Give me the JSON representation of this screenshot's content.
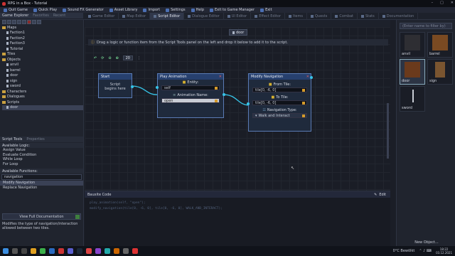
{
  "window": {
    "title": "RPG in a Box - Tutorial"
  },
  "menu": [
    {
      "label": "Quit Game"
    },
    {
      "label": "Quick Play"
    },
    {
      "label": "Sound FX Generator"
    },
    {
      "label": "Asset Library"
    },
    {
      "label": "Import"
    },
    {
      "label": "Settings"
    },
    {
      "label": "Help"
    },
    {
      "label": "Exit to Game Manager"
    },
    {
      "label": "Exit"
    }
  ],
  "tabs": [
    {
      "label": "Game Editor"
    },
    {
      "label": "Map Editor"
    },
    {
      "label": "Script Editor"
    },
    {
      "label": "Dialogue Editor"
    },
    {
      "label": "UI Editor"
    },
    {
      "label": "Effect Editor"
    },
    {
      "label": "Items"
    },
    {
      "label": "Quests"
    },
    {
      "label": "Combat"
    },
    {
      "label": "Stats"
    },
    {
      "label": "Documentation"
    }
  ],
  "left": {
    "explorer_tabs": [
      "Game Explorer",
      "Favorites",
      "Recent"
    ],
    "tree": [
      {
        "label": "Maps",
        "type": "folder"
      },
      {
        "label": "Faction1",
        "type": "file"
      },
      {
        "label": "Faction2",
        "type": "file"
      },
      {
        "label": "Faction3",
        "type": "file"
      },
      {
        "label": "Tutorial",
        "type": "file"
      },
      {
        "label": "Tiles",
        "type": "folder"
      },
      {
        "label": "Objects",
        "type": "folder"
      },
      {
        "label": "anvil",
        "type": "file"
      },
      {
        "label": "barrel",
        "type": "file"
      },
      {
        "label": "door",
        "type": "file"
      },
      {
        "label": "sign",
        "type": "file"
      },
      {
        "label": "sword",
        "type": "file"
      },
      {
        "label": "Characters",
        "type": "folder"
      },
      {
        "label": "Dialogues",
        "type": "folder"
      },
      {
        "label": "Scripts",
        "type": "folder"
      },
      {
        "label": "door",
        "type": "file",
        "selected": true
      }
    ],
    "tools_tabs": [
      "Script Tools",
      "Properties"
    ],
    "logic_header": "Available Logic:",
    "logic": [
      "Assign Value",
      "Evaluate Condition",
      "While Loop",
      "For Loop"
    ],
    "functions_header": "Available Functions:",
    "search_value": "navigation",
    "functions": [
      "Modify Navigation",
      "Replace Navigation"
    ],
    "doc_button": "View Full Documentation",
    "description": "Modifies the type of navigation/interaction allowed between two tiles."
  },
  "editor": {
    "script_tab": "door",
    "info": "Drag a logic or function item from the Script Tools panel on the left and drop it below to add it to the script.",
    "zoom": "20",
    "nodes": {
      "start": {
        "title": "Start",
        "text": "Script begins here"
      },
      "play": {
        "title": "Play Animation",
        "entity_label": "Entity:",
        "entity_value": "self",
        "anim_label": "Animation Name:",
        "anim_value": "open"
      },
      "modify": {
        "title": "Modify Navigation",
        "from_label": "From Tile:",
        "from_value": "tile[0, -6, 0]",
        "to_label": "To Tile:",
        "to_value": "tile[0, -6, 0]",
        "type_label": "Navigation Type:",
        "type_value": "Walk and Interact"
      }
    },
    "preview": {
      "title": "Bauxite Code",
      "edit": "Edit",
      "line1": "play_animation(self, \"open\");",
      "line2": "modify_navigation(tile[0, -6, 0], tile[0, -6, 0], WALK_AND_INTERACT);"
    }
  },
  "right": {
    "filter_placeholder": "(Enter name to filter by)",
    "items": [
      {
        "label": "anvil"
      },
      {
        "label": "barrel"
      },
      {
        "label": "door",
        "selected": true
      },
      {
        "label": "sign"
      },
      {
        "label": "sword"
      }
    ],
    "new_object": "New Object..."
  },
  "taskbar": {
    "weather": "0°C Bewölkt",
    "time": "18:22",
    "date": "03.12.2021"
  }
}
